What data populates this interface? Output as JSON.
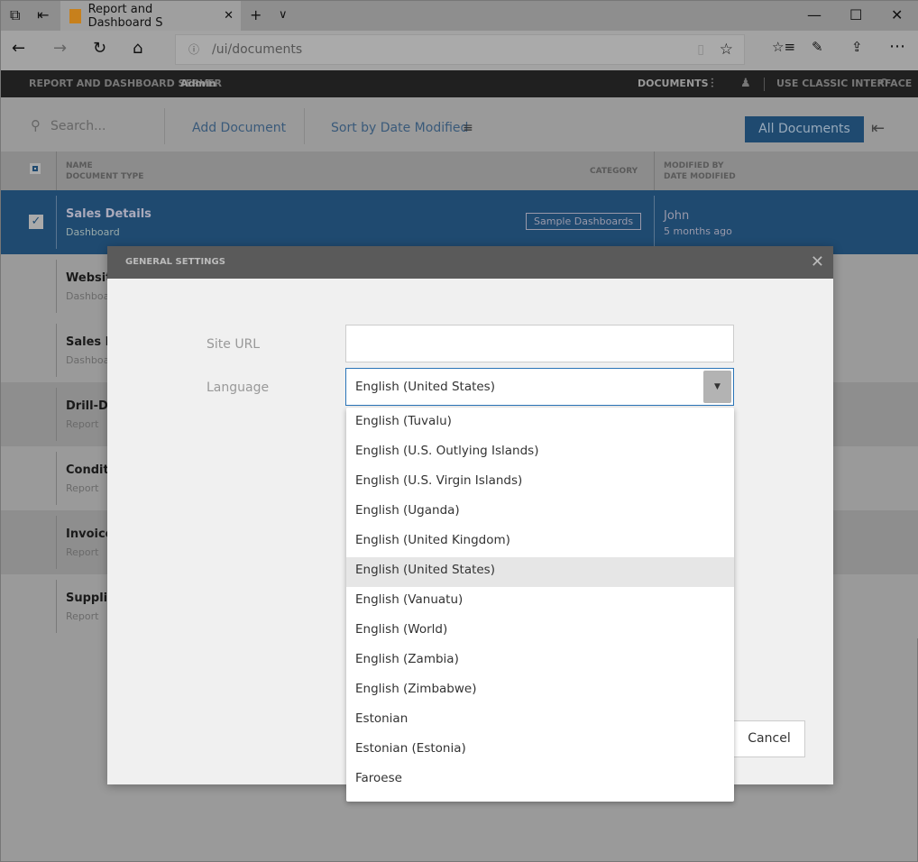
{
  "browser": {
    "tab_title": "Report and Dashboard S",
    "url": "/ui/documents"
  },
  "appbar": {
    "title": "REPORT AND DASHBOARD SERVER",
    "user": "Admin",
    "documents": "DOCUMENTS",
    "classic": "USE CLASSIC INTERFACE"
  },
  "toolbar": {
    "search_placeholder": "Search...",
    "add": "Add Document",
    "sort": "Sort by Date Modified",
    "all_docs": "All Documents"
  },
  "columns": {
    "name": "NAME",
    "type": "DOCUMENT TYPE",
    "category": "CATEGORY",
    "modified_by": "MODIFIED BY",
    "date": "DATE MODIFIED"
  },
  "rows": [
    {
      "name": "Sales Details",
      "type": "Dashboard",
      "category": "Sample Dashboards",
      "modified_by": "John",
      "date": "5 months ago"
    },
    {
      "name": "Websit",
      "type": "Dashboar"
    },
    {
      "name": "Sales P",
      "type": "Dashboar"
    },
    {
      "name": "Drill-Do",
      "type": "Report"
    },
    {
      "name": "Conditi",
      "type": "Report"
    },
    {
      "name": "Invoice",
      "type": "Report"
    },
    {
      "name": "Supplie",
      "type": "Report"
    }
  ],
  "modal": {
    "title": "GENERAL SETTINGS",
    "site_url_label": "Site URL",
    "site_url_value": "",
    "language_label": "Language",
    "language_value": "English (United States)",
    "cancel": "Cancel",
    "options": [
      "English (Tuvalu)",
      "English (U.S. Outlying Islands)",
      "English (U.S. Virgin Islands)",
      "English (Uganda)",
      "English (United Kingdom)",
      "English (United States)",
      "English (Vanuatu)",
      "English (World)",
      "English (Zambia)",
      "English (Zimbabwe)",
      "Estonian",
      "Estonian (Estonia)",
      "Faroese"
    ],
    "selected_index": 5
  }
}
